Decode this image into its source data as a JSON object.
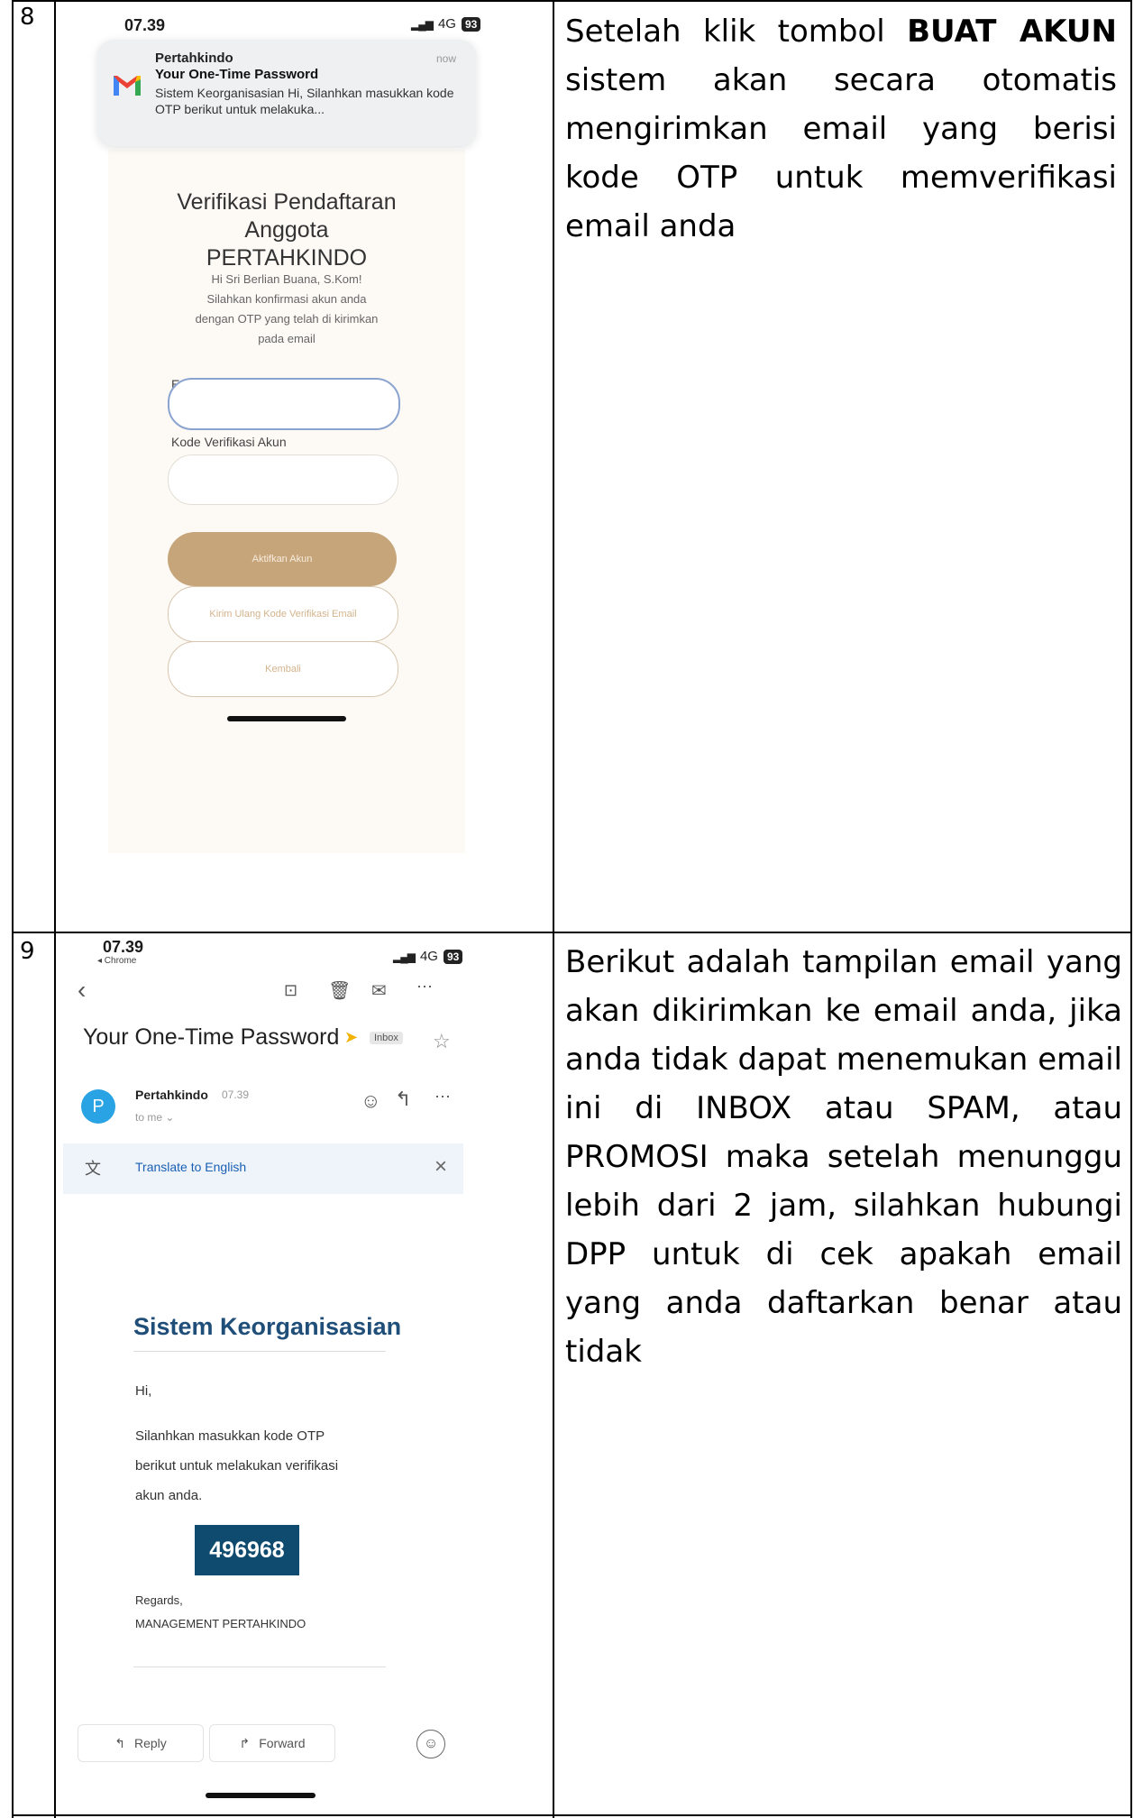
{
  "table": {
    "rows": [
      {
        "number": "8",
        "description_pre": "Setelah klik tombol ",
        "description_bold": "BUAT AKUN",
        "description_post": " sistem akan secara otomatis mengirimkan email yang berisi kode OTP untuk memverifikasi email anda"
      },
      {
        "number": "9",
        "description": "Berikut adalah tampilan email yang akan dikirimkan ke email anda, jika anda tidak dapat menemukan email ini di INBOX atau SPAM, atau PROMOSI maka setelah menunggu lebih dari 2 jam, silahkan hubungi DPP untuk di cek apakah email yang anda daftarkan benar atau tidak"
      }
    ]
  },
  "screen1": {
    "status": {
      "time": "07.39",
      "network": "4G",
      "battery": "93"
    },
    "notification": {
      "app": "Pertahkindo",
      "time": "now",
      "title": "Your One-Time Password",
      "body": "Sistem Keorganisasian Hi, Silanhkan masukkan kode OTP berikut untuk melakuka..."
    },
    "form": {
      "title_line1": "Verifikasi Pendaftaran",
      "title_line2": "Anggota",
      "title_line3": "PERTAHKINDO",
      "greeting_line1": "Hi Sri Berlian Buana, S.Kom!",
      "greeting_line2": "Silahkan konfirmasi akun anda",
      "greeting_line3": "dengan OTP yang telah di kirimkan",
      "greeting_line4": "pada email",
      "email_label": "Email",
      "email_value": "",
      "code_label": "Kode Verifikasi Akun",
      "code_value": "",
      "activate_button": "Aktifkan Akun",
      "resend_button": "Kirim Ulang Kode Verifikasi Email",
      "back_button": "Kembali"
    }
  },
  "screen2": {
    "status": {
      "time": "07.39",
      "back_app": "◂ Chrome",
      "network": "4G",
      "battery": "93"
    },
    "subject": "Your One-Time Password",
    "label": "Inbox",
    "sender": "Pertahkindo",
    "sender_time": "07.39",
    "to": "to me",
    "avatar_letter": "P",
    "translate": "Translate to English",
    "email": {
      "heading": "Sistem Keorganisasian",
      "greeting": "Hi,",
      "line1": "Silanhkan masukkan kode OTP",
      "line2": "berikut untuk melakukan verifikasi",
      "line3": "akun anda.",
      "otp": "496968",
      "regards": "Regards,",
      "signature": "MANAGEMENT PERTAHKINDO"
    },
    "reply_button": "Reply",
    "forward_button": "Forward"
  }
}
